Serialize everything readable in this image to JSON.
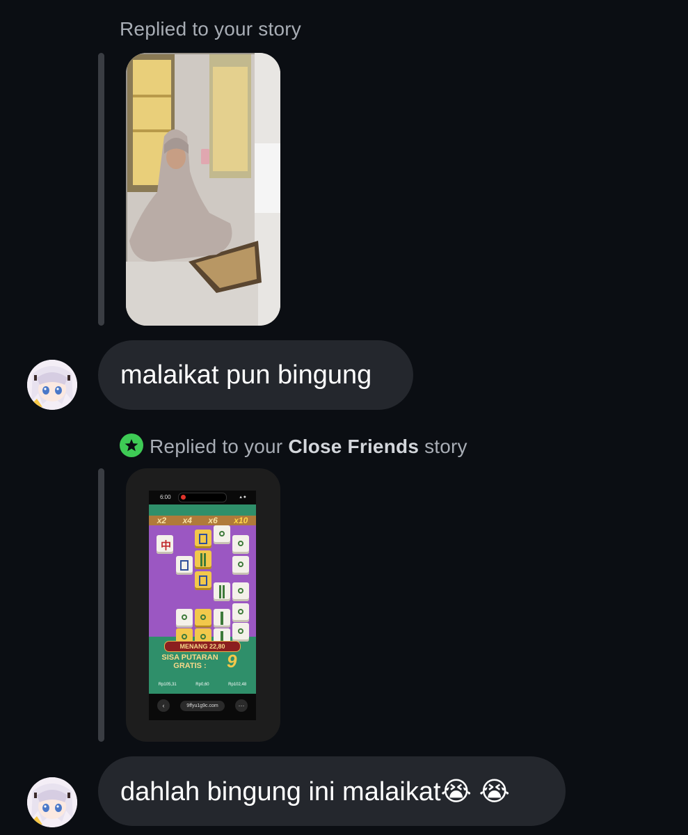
{
  "messages": [
    {
      "reply_label": "Replied to your story",
      "story_image": "selfie-in-mirror",
      "text": "malaikat pun bingung",
      "avatar": "anime-avatar"
    },
    {
      "reply_label_prefix": "Replied to your",
      "reply_label_bold": "Close Friends",
      "reply_label_suffix": "story",
      "story_image": "slot-game-screenshot",
      "text": "dahlah bingung ini malaikat😭 😭",
      "avatar": "anime-avatar"
    }
  ],
  "story_game": {
    "status_time": "6:00",
    "multipliers": [
      "x2",
      "x4",
      "x6",
      "x10"
    ],
    "win_label": "MENANG 22,80",
    "free_spins_label": "SISA PUTARAN GRATIS :",
    "free_spins_value": "9",
    "balances": [
      "Rp105,31",
      "Rp0,60",
      "Rp102,48"
    ],
    "url": "9ffyu1g9c.com"
  },
  "colors": {
    "background": "#0b0e13",
    "bubble": "#24272d",
    "close_friends": "#3ecb55"
  }
}
